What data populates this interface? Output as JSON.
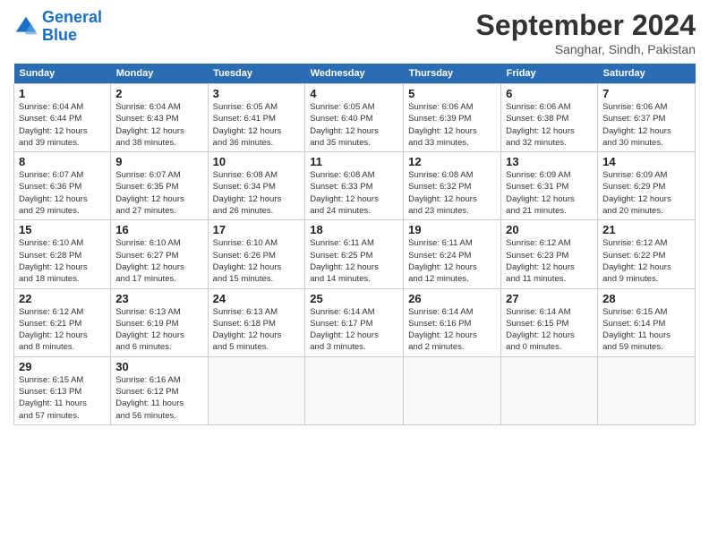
{
  "header": {
    "logo_line1": "General",
    "logo_line2": "Blue",
    "month": "September 2024",
    "location": "Sanghar, Sindh, Pakistan"
  },
  "weekdays": [
    "Sunday",
    "Monday",
    "Tuesday",
    "Wednesday",
    "Thursday",
    "Friday",
    "Saturday"
  ],
  "weeks": [
    [
      {
        "day": "1",
        "info": "Sunrise: 6:04 AM\nSunset: 6:44 PM\nDaylight: 12 hours\nand 39 minutes."
      },
      {
        "day": "2",
        "info": "Sunrise: 6:04 AM\nSunset: 6:43 PM\nDaylight: 12 hours\nand 38 minutes."
      },
      {
        "day": "3",
        "info": "Sunrise: 6:05 AM\nSunset: 6:41 PM\nDaylight: 12 hours\nand 36 minutes."
      },
      {
        "day": "4",
        "info": "Sunrise: 6:05 AM\nSunset: 6:40 PM\nDaylight: 12 hours\nand 35 minutes."
      },
      {
        "day": "5",
        "info": "Sunrise: 6:06 AM\nSunset: 6:39 PM\nDaylight: 12 hours\nand 33 minutes."
      },
      {
        "day": "6",
        "info": "Sunrise: 6:06 AM\nSunset: 6:38 PM\nDaylight: 12 hours\nand 32 minutes."
      },
      {
        "day": "7",
        "info": "Sunrise: 6:06 AM\nSunset: 6:37 PM\nDaylight: 12 hours\nand 30 minutes."
      }
    ],
    [
      {
        "day": "8",
        "info": "Sunrise: 6:07 AM\nSunset: 6:36 PM\nDaylight: 12 hours\nand 29 minutes."
      },
      {
        "day": "9",
        "info": "Sunrise: 6:07 AM\nSunset: 6:35 PM\nDaylight: 12 hours\nand 27 minutes."
      },
      {
        "day": "10",
        "info": "Sunrise: 6:08 AM\nSunset: 6:34 PM\nDaylight: 12 hours\nand 26 minutes."
      },
      {
        "day": "11",
        "info": "Sunrise: 6:08 AM\nSunset: 6:33 PM\nDaylight: 12 hours\nand 24 minutes."
      },
      {
        "day": "12",
        "info": "Sunrise: 6:08 AM\nSunset: 6:32 PM\nDaylight: 12 hours\nand 23 minutes."
      },
      {
        "day": "13",
        "info": "Sunrise: 6:09 AM\nSunset: 6:31 PM\nDaylight: 12 hours\nand 21 minutes."
      },
      {
        "day": "14",
        "info": "Sunrise: 6:09 AM\nSunset: 6:29 PM\nDaylight: 12 hours\nand 20 minutes."
      }
    ],
    [
      {
        "day": "15",
        "info": "Sunrise: 6:10 AM\nSunset: 6:28 PM\nDaylight: 12 hours\nand 18 minutes."
      },
      {
        "day": "16",
        "info": "Sunrise: 6:10 AM\nSunset: 6:27 PM\nDaylight: 12 hours\nand 17 minutes."
      },
      {
        "day": "17",
        "info": "Sunrise: 6:10 AM\nSunset: 6:26 PM\nDaylight: 12 hours\nand 15 minutes."
      },
      {
        "day": "18",
        "info": "Sunrise: 6:11 AM\nSunset: 6:25 PM\nDaylight: 12 hours\nand 14 minutes."
      },
      {
        "day": "19",
        "info": "Sunrise: 6:11 AM\nSunset: 6:24 PM\nDaylight: 12 hours\nand 12 minutes."
      },
      {
        "day": "20",
        "info": "Sunrise: 6:12 AM\nSunset: 6:23 PM\nDaylight: 12 hours\nand 11 minutes."
      },
      {
        "day": "21",
        "info": "Sunrise: 6:12 AM\nSunset: 6:22 PM\nDaylight: 12 hours\nand 9 minutes."
      }
    ],
    [
      {
        "day": "22",
        "info": "Sunrise: 6:12 AM\nSunset: 6:21 PM\nDaylight: 12 hours\nand 8 minutes."
      },
      {
        "day": "23",
        "info": "Sunrise: 6:13 AM\nSunset: 6:19 PM\nDaylight: 12 hours\nand 6 minutes."
      },
      {
        "day": "24",
        "info": "Sunrise: 6:13 AM\nSunset: 6:18 PM\nDaylight: 12 hours\nand 5 minutes."
      },
      {
        "day": "25",
        "info": "Sunrise: 6:14 AM\nSunset: 6:17 PM\nDaylight: 12 hours\nand 3 minutes."
      },
      {
        "day": "26",
        "info": "Sunrise: 6:14 AM\nSunset: 6:16 PM\nDaylight: 12 hours\nand 2 minutes."
      },
      {
        "day": "27",
        "info": "Sunrise: 6:14 AM\nSunset: 6:15 PM\nDaylight: 12 hours\nand 0 minutes."
      },
      {
        "day": "28",
        "info": "Sunrise: 6:15 AM\nSunset: 6:14 PM\nDaylight: 11 hours\nand 59 minutes."
      }
    ],
    [
      {
        "day": "29",
        "info": "Sunrise: 6:15 AM\nSunset: 6:13 PM\nDaylight: 11 hours\nand 57 minutes."
      },
      {
        "day": "30",
        "info": "Sunrise: 6:16 AM\nSunset: 6:12 PM\nDaylight: 11 hours\nand 56 minutes."
      },
      {
        "day": "",
        "info": ""
      },
      {
        "day": "",
        "info": ""
      },
      {
        "day": "",
        "info": ""
      },
      {
        "day": "",
        "info": ""
      },
      {
        "day": "",
        "info": ""
      }
    ]
  ]
}
